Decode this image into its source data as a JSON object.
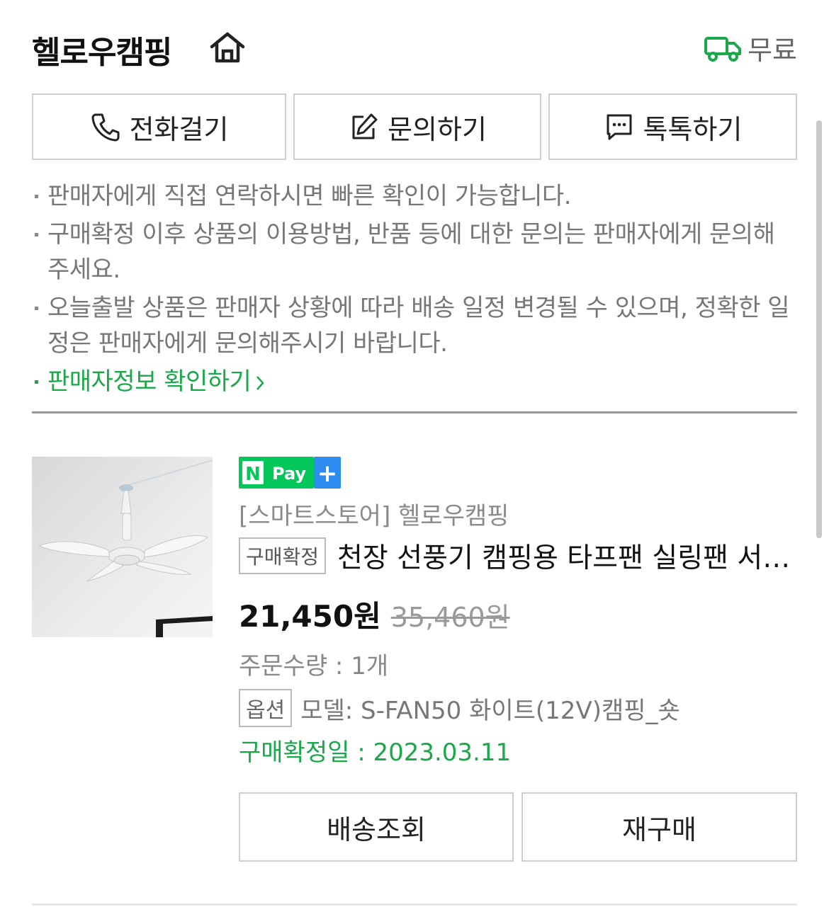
{
  "store": {
    "name": "헬로우캠핑",
    "home_icon": "home-icon",
    "shipping_label": "무료",
    "shipping_icon": "truck-icon",
    "shipping_color": "#1aa84b"
  },
  "contact_buttons": [
    {
      "label": "전화걸기",
      "icon": "phone-icon"
    },
    {
      "label": "문의하기",
      "icon": "edit-icon"
    },
    {
      "label": "톡톡하기",
      "icon": "chat-icon"
    }
  ],
  "notes": {
    "items": [
      "판매자에게 직접 연락하시면 빠른 확인이 가능합니다.",
      "구매확정 이후 상품의 이용방법, 반품 등에 대한 문의는 판매자에게 문의해 주세요.",
      "오늘출발 상품은 판매자 상황에 따라 배송 일정 변경될 수 있으며, 정확한 일정은 판매자에게 문의해주시기 바랍니다."
    ],
    "seller_info_link": "판매자정보 확인하기"
  },
  "order": {
    "badge": {
      "n": "N",
      "pay": "Pay",
      "plus": "+"
    },
    "store_line": "[스마트스토어] 헬로우캠핑",
    "status_tag": "구매확정",
    "title": "천장 선풍기 캠핑용 타프팬 실링팬 서큘레이터",
    "price": "21,450원",
    "original_price": "35,460원",
    "quantity": "주문수량 : 1개",
    "option_tag": "옵션",
    "option_value": "모델: S-FAN50 화이트(12V)캠핑_숏",
    "confirm_date": "구매확정일 : 2023.03.11",
    "buttons": {
      "track": "배송조회",
      "rebuy": "재구매"
    }
  },
  "colors": {
    "accent_green": "#1aa84b",
    "npay_green": "#03c75a",
    "npay_blue": "#2d8cf0"
  }
}
